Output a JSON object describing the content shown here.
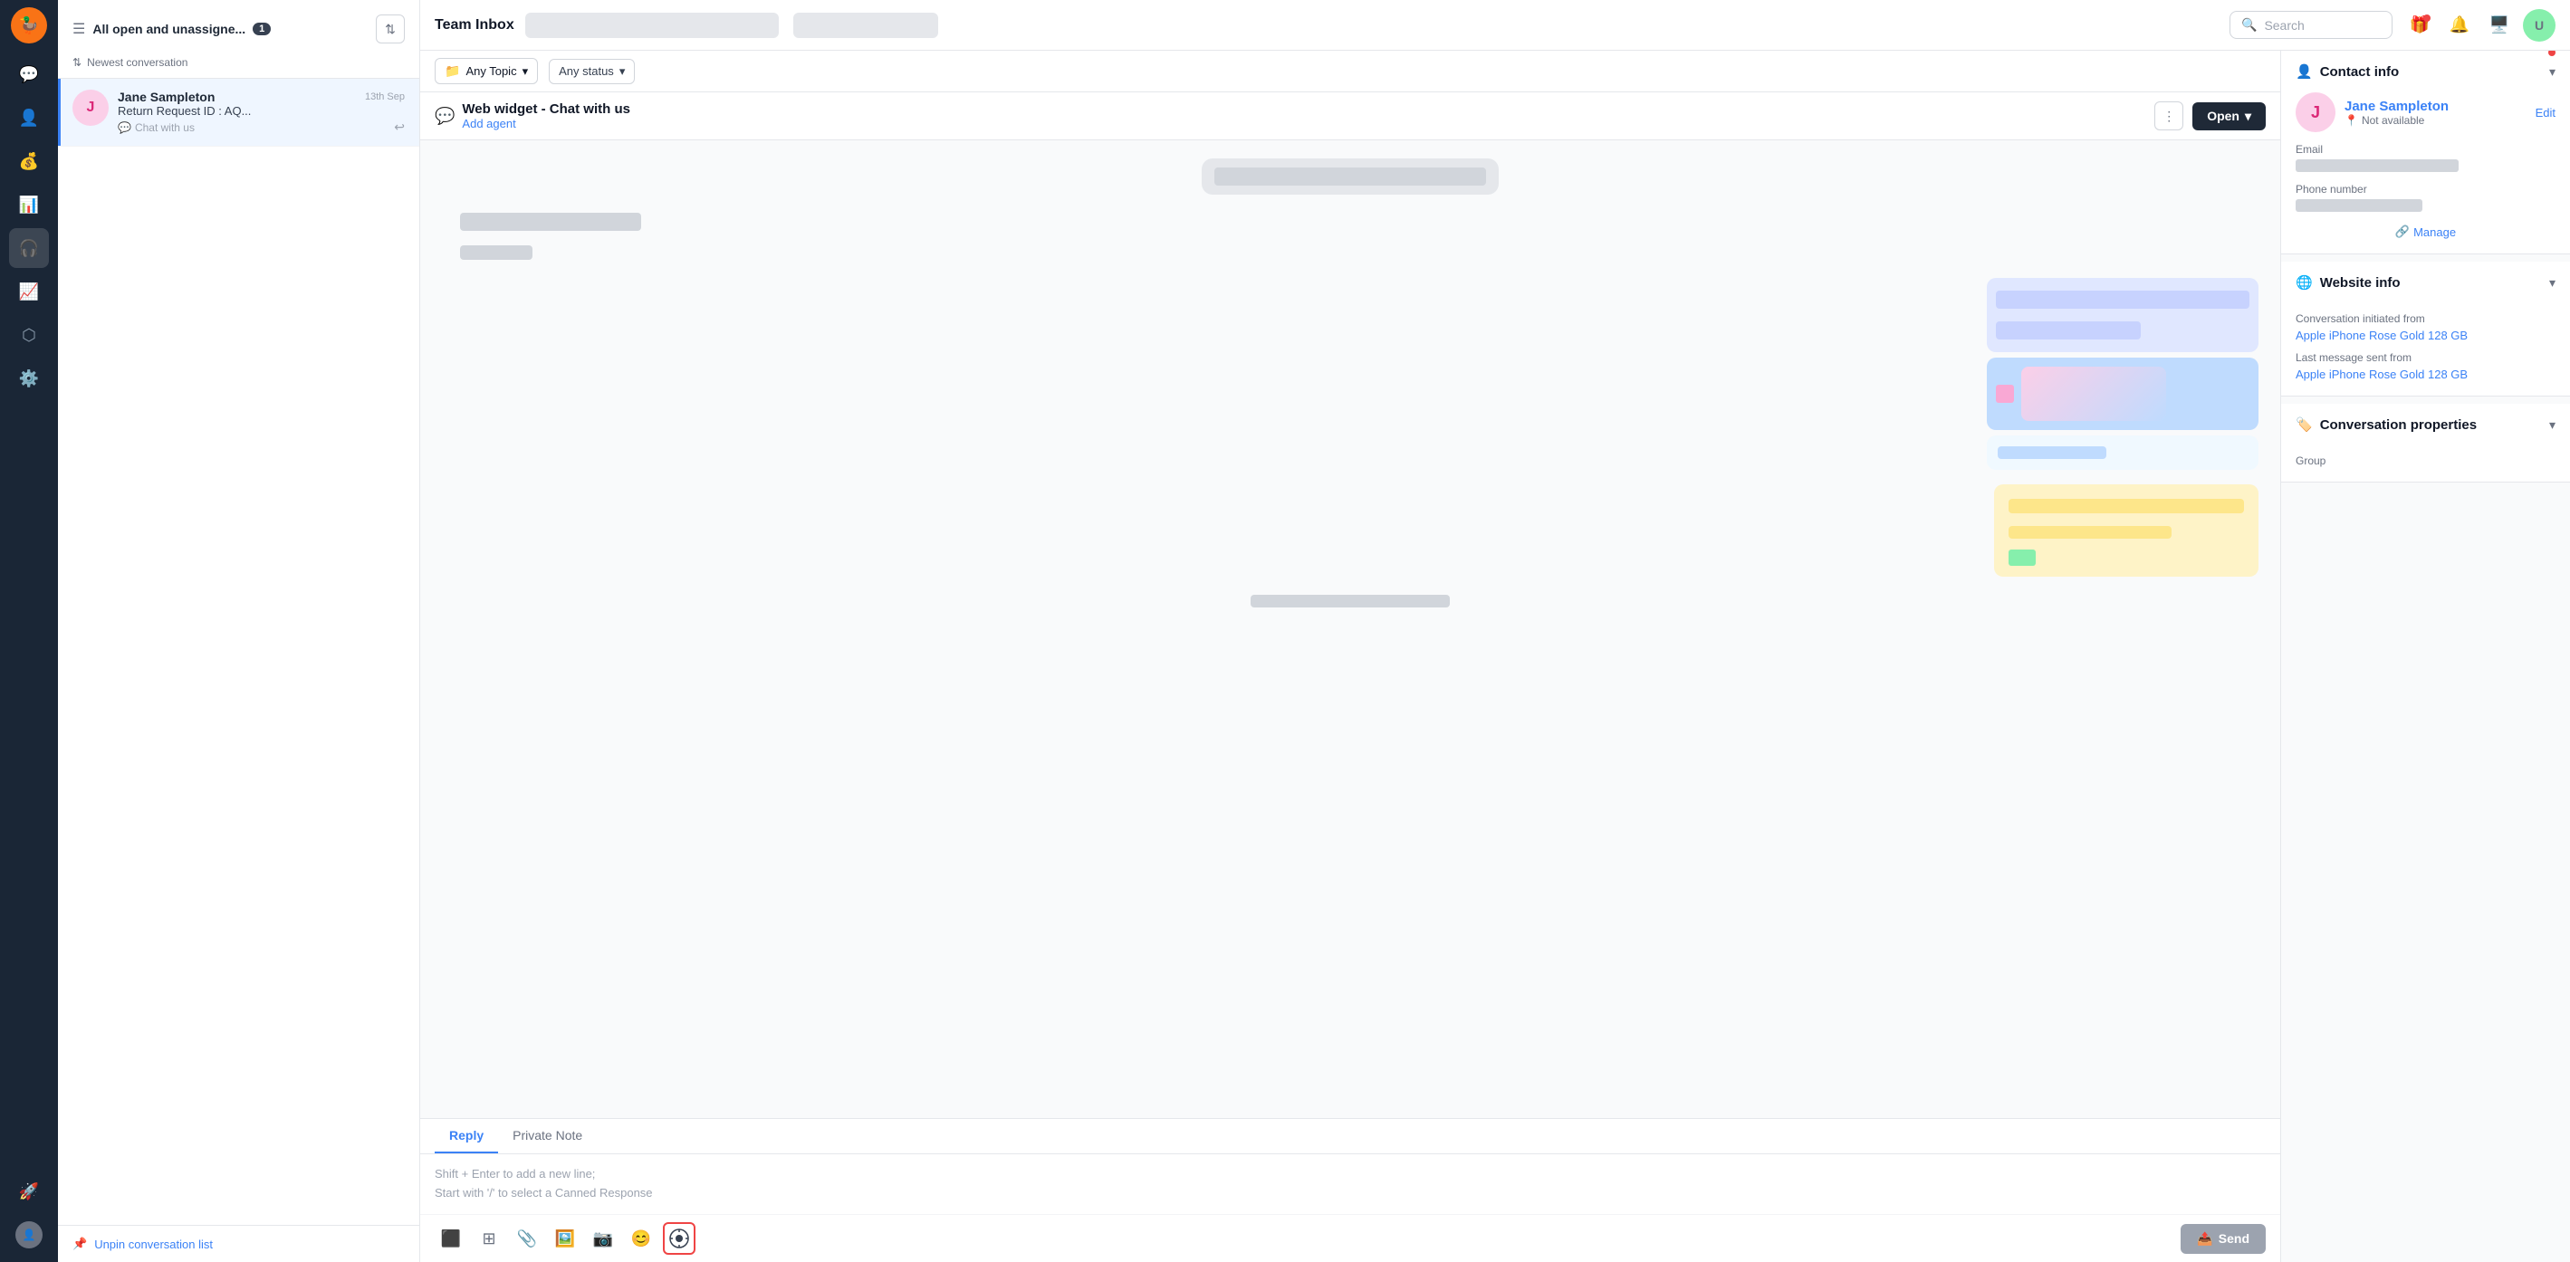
{
  "app": {
    "title": "Team Inbox"
  },
  "topbar": {
    "search_placeholder": "Search",
    "search_label": "Search"
  },
  "sidebar": {
    "nav_items": [
      {
        "id": "conversations",
        "icon": "💬",
        "label": "Conversations"
      },
      {
        "id": "contacts",
        "icon": "👤",
        "label": "Contacts"
      },
      {
        "id": "billing",
        "icon": "💰",
        "label": "Billing"
      },
      {
        "id": "reports",
        "icon": "📊",
        "label": "Reports"
      },
      {
        "id": "help",
        "icon": "🎧",
        "label": "Help",
        "active": true
      },
      {
        "id": "analytics",
        "icon": "📈",
        "label": "Analytics"
      },
      {
        "id": "integrations",
        "icon": "🔗",
        "label": "Integrations"
      },
      {
        "id": "settings",
        "icon": "⚙️",
        "label": "Settings"
      },
      {
        "id": "launch",
        "icon": "🚀",
        "label": "Launch"
      }
    ]
  },
  "conv_panel": {
    "header": "All open and unassigne...",
    "count": "1",
    "sort_label": "Newest conversation",
    "unpin_label": "Unpin conversation list"
  },
  "conversation": {
    "name": "Jane Sampleton",
    "date": "13th Sep",
    "subject": "Return Request ID : AQ...",
    "channel": "Chat with us",
    "avatar_letter": "J"
  },
  "filter": {
    "topic_label": "Any Topic",
    "status_label": "Any status"
  },
  "chat_header": {
    "subject": "Web widget - Chat with us",
    "add_agent": "Add agent",
    "open_label": "Open",
    "more_options": "More options"
  },
  "reply": {
    "tab_reply": "Reply",
    "tab_private": "Private Note",
    "placeholder_line1": "Shift + Enter to add a new line;",
    "placeholder_line2": "Start with '/' to select a Canned Response",
    "send_label": "Send"
  },
  "contact_info": {
    "section_title": "Contact info",
    "name": "Jane Sampleton",
    "avatar_letter": "J",
    "location": "Not available",
    "edit_label": "Edit",
    "email_label": "Email",
    "phone_label": "Phone number",
    "manage_label": "Manage"
  },
  "website_info": {
    "section_title": "Website info",
    "conv_from_label": "Conversation initiated from",
    "conv_from_value": "Apple iPhone Rose Gold 128 GB",
    "last_msg_label": "Last message sent from",
    "last_msg_value": "Apple iPhone Rose Gold 128 GB"
  },
  "conv_props": {
    "section_title": "Conversation properties",
    "group_label": "Group"
  }
}
